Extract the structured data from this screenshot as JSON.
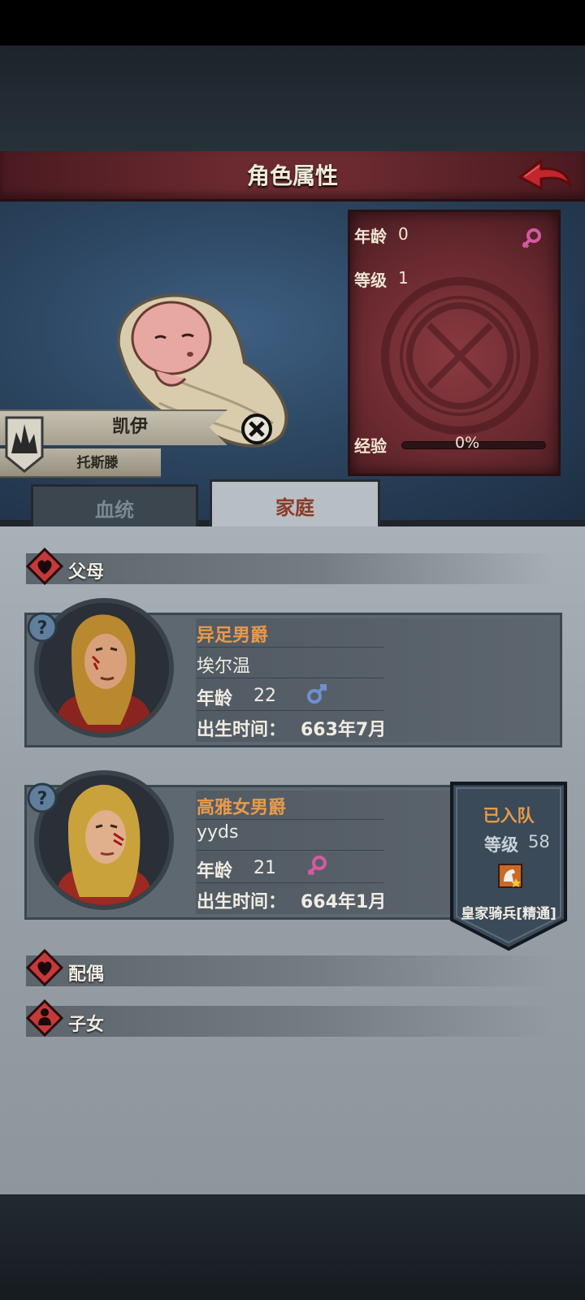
{
  "header": {
    "title": "角色属性",
    "back_icon": "back-arrow-icon"
  },
  "character": {
    "name": "凯伊",
    "house": "托斯滕",
    "stats": {
      "age_label": "年龄",
      "age_value": "0",
      "level_label": "等级",
      "level_value": "1",
      "xp_label": "经验",
      "xp_value": "0%",
      "xp_progress": 0,
      "gender_icon": "female-icon"
    }
  },
  "tabs": {
    "bloodline": "血统",
    "family": "家庭",
    "active": "family"
  },
  "sections": {
    "parents": "父母",
    "spouse": "配偶",
    "children": "子女"
  },
  "parents": [
    {
      "title": "异足男爵",
      "name": "埃尔温",
      "age_label": "年龄",
      "age": "22",
      "gender_icon": "male-icon",
      "birth_label": "出生时间：",
      "birth": "663年7月"
    },
    {
      "title": "高雅女男爵",
      "name": "yyds",
      "age_label": "年龄",
      "age": "21",
      "gender_icon": "female-icon",
      "birth_label": "出生时间：",
      "birth": "664年1月",
      "party": {
        "status": "已入队",
        "level_label": "等级",
        "level": "58",
        "class": "皇家骑兵[精通]",
        "class_icon": "cavalry-icon"
      }
    }
  ],
  "colors": {
    "accent_orange": "#e89a4a",
    "header_red": "#6b2a30",
    "panel_red": "#6a2a30",
    "female_pink": "#d45aa0",
    "male_blue": "#6f8fd0"
  }
}
